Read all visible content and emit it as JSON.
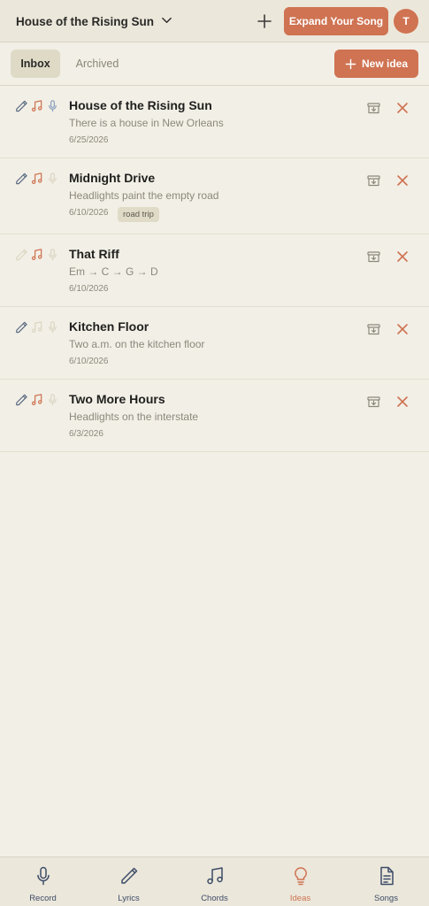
{
  "header": {
    "song_title": "House of the Rising Sun",
    "expand_label": "Expand Your Song",
    "avatar_initial": "T"
  },
  "tabs": {
    "inbox": "Inbox",
    "archived": "Archived",
    "active": "Inbox"
  },
  "new_idea_label": "New idea",
  "ideas": [
    {
      "title": "House of the Rising Sun",
      "subtitle": "There is a house in New Orleans",
      "date": "6/25/2026",
      "tag": "",
      "has_lyrics": true,
      "has_chords": true,
      "has_recording": true
    },
    {
      "title": "Midnight Drive",
      "subtitle": "Headlights paint the empty road",
      "date": "6/10/2026",
      "tag": "road trip",
      "has_lyrics": true,
      "has_chords": true,
      "has_recording": false
    },
    {
      "title": "That Riff",
      "subtitle": "Em → C → G → D",
      "date": "6/10/2026",
      "tag": "",
      "has_lyrics": false,
      "has_chords": true,
      "has_recording": false
    },
    {
      "title": "Kitchen Floor",
      "subtitle": "Two a.m. on the kitchen floor",
      "date": "6/10/2026",
      "tag": "",
      "has_lyrics": true,
      "has_chords": false,
      "has_recording": false
    },
    {
      "title": "Two More Hours",
      "subtitle": "Headlights on the interstate",
      "date": "6/3/2026",
      "tag": "",
      "has_lyrics": true,
      "has_chords": true,
      "has_recording": false
    }
  ],
  "bottom_nav": [
    {
      "label": "Record",
      "icon": "microphone-icon",
      "active": false
    },
    {
      "label": "Lyrics",
      "icon": "pencil-icon",
      "active": false
    },
    {
      "label": "Chords",
      "icon": "music-note-icon",
      "active": false
    },
    {
      "label": "Ideas",
      "icon": "lightbulb-icon",
      "active": true
    },
    {
      "label": "Songs",
      "icon": "document-icon",
      "active": false
    }
  ],
  "colors": {
    "accent": "#cf7352",
    "lyrics_active": "#5a6a82",
    "recording_active": "#8aa0bd",
    "inactive_icon": "#dcd6c3",
    "nav_text": "#3d4c68"
  }
}
